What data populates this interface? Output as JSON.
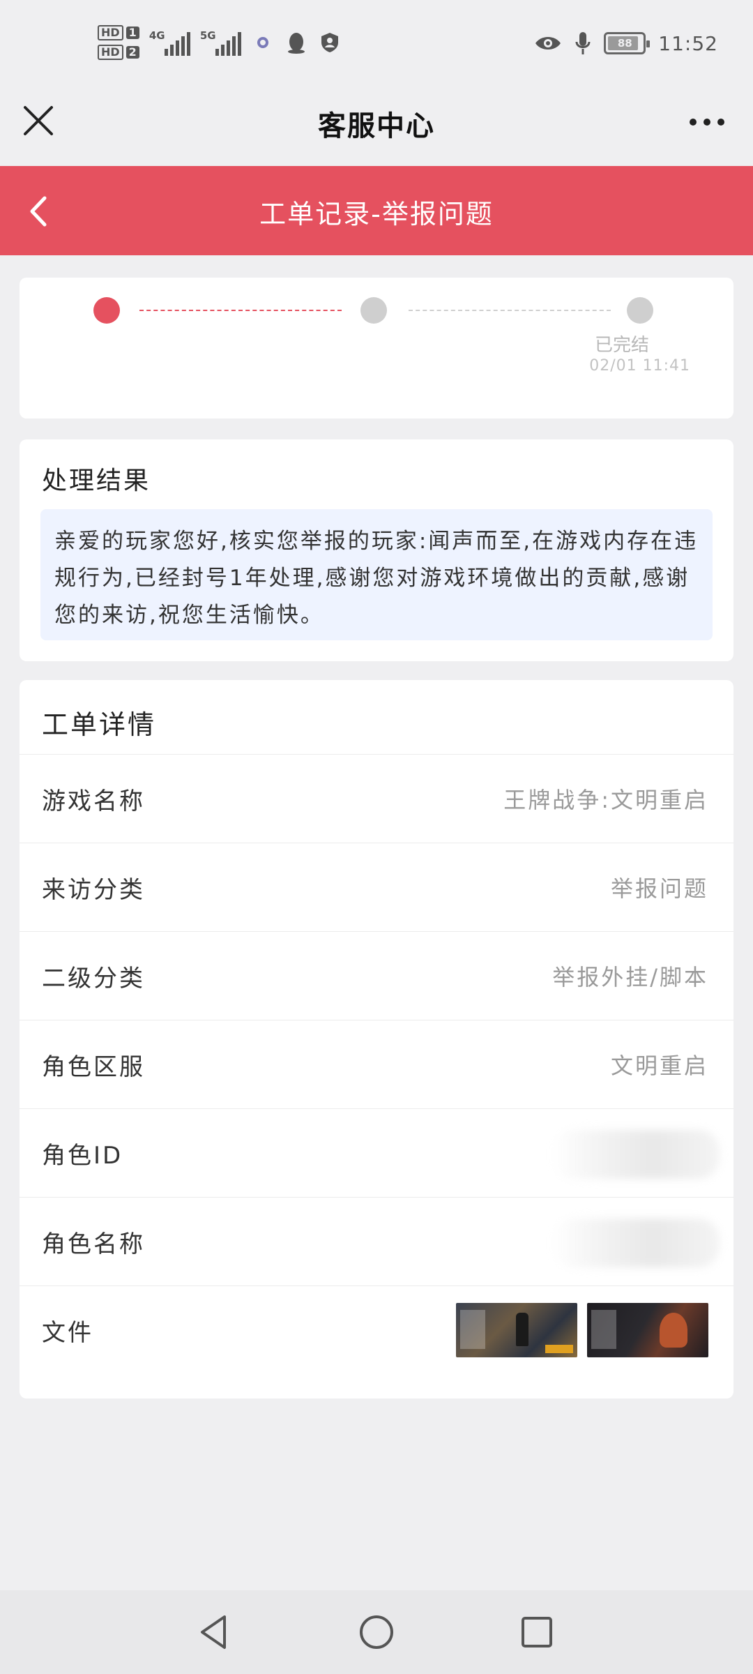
{
  "status_bar": {
    "time": "11:52",
    "battery": "88",
    "sim1_label": "HD",
    "sim1_num": "1",
    "sim2_label": "HD",
    "sim2_num": "2",
    "net1": "4G",
    "net2": "5G"
  },
  "topnav": {
    "title": "客服中心"
  },
  "header": {
    "title": "工单记录-举报问题"
  },
  "progress": {
    "final_step_label": "已完结",
    "final_step_time": "02/01 11:41"
  },
  "result": {
    "heading": "处理结果",
    "text": "亲爱的玩家您好,核实您举报的玩家:闻声而至,在游戏内存在违规行为,已经封号1年处理,感谢您对游戏环境做出的贡献,感谢您的来访,祝您生活愉快。"
  },
  "details": {
    "heading": "工单详情",
    "rows": [
      {
        "key": "游戏名称",
        "value": "王牌战争:文明重启"
      },
      {
        "key": "来访分类",
        "value": "举报问题"
      },
      {
        "key": "二级分类",
        "value": "举报外挂/脚本"
      },
      {
        "key": "角色区服",
        "value": "文明重启"
      },
      {
        "key": "角色ID",
        "value": ""
      },
      {
        "key": "角色名称",
        "value": ""
      },
      {
        "key": "文件",
        "value": ""
      }
    ]
  },
  "colors": {
    "accent": "#e5515f",
    "inactive_step": "#cfcfcf",
    "result_bg": "#eef3ff"
  },
  "icons": {
    "close": "close-icon",
    "more": "more-icon",
    "back": "chevron-left-icon",
    "nav_back": "triangle-back-icon",
    "nav_home": "circle-home-icon",
    "nav_recent": "square-recent-icon"
  }
}
